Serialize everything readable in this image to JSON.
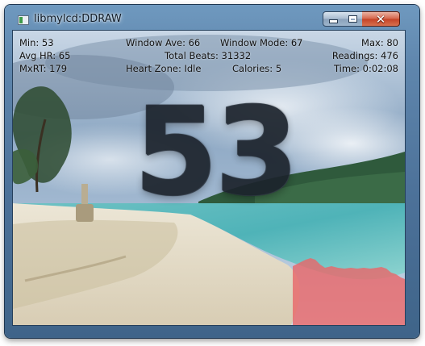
{
  "window": {
    "title": "libmylcd:DDRAW",
    "minimize_label": "",
    "maximize_label": "",
    "close_label": "✕"
  },
  "stats": {
    "min": "Min: 53",
    "window_ave": "Window Ave: 66",
    "window_mode": "Window Mode: 67",
    "max": "Max: 80",
    "avg_hr": "Avg HR: 65",
    "total_beats": "Total Beats: 31332",
    "readings": "Readings: 476",
    "mxrt": "MxRT: 179",
    "heart_zone": "Heart Zone: Idle",
    "calories": "Calories: 5",
    "time": "Time: 0:02:08"
  },
  "current_hr": "53",
  "colors": {
    "graph_fill": "#e8686a",
    "big_digits": "#1c232c"
  },
  "icons": [
    "app-icon",
    "minimize-icon",
    "maximize-icon",
    "close-icon"
  ]
}
